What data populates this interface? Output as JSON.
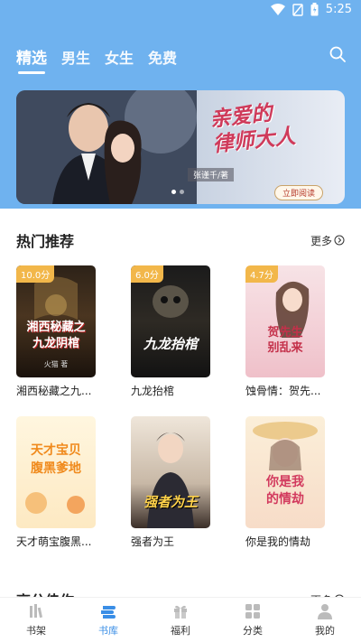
{
  "status": {
    "time": "5:25"
  },
  "tabs": [
    {
      "label": "精选",
      "active": true
    },
    {
      "label": "男生",
      "active": false
    },
    {
      "label": "女生",
      "active": false
    },
    {
      "label": "免费",
      "active": false
    }
  ],
  "banner": {
    "title_line1": "亲爱的",
    "title_line2": "律师大人",
    "author": "张谨千/著",
    "button": "立即阅读",
    "active_dot": 0
  },
  "hot": {
    "title": "热门推荐",
    "more": "更多",
    "books": [
      {
        "name": "湘西秘藏之九...",
        "score": "10.0分",
        "cover_text": "湘西秘藏之\n九龙阴棺",
        "cover_sub": "火猫 著"
      },
      {
        "name": "九龙抬棺",
        "score": "6.0分",
        "cover_text": "九龙抬棺",
        "cover_sub": ""
      },
      {
        "name": "蚀骨情：贺先...",
        "score": "4.7分",
        "cover_text": "贺先生\n别乱来",
        "cover_sub": ""
      },
      {
        "name": "天才萌宝腹黑...",
        "score": "",
        "cover_text": "天才宝贝\n腹黑爹地",
        "cover_sub": ""
      },
      {
        "name": "强者为王",
        "score": "",
        "cover_text": "强者为王",
        "cover_sub": ""
      },
      {
        "name": "你是我的情劫",
        "score": "",
        "cover_text": "你是我\n的情劫",
        "cover_sub": ""
      }
    ]
  },
  "next_section": {
    "title": "高分佳作",
    "more": "更多"
  },
  "nav": [
    {
      "label": "书架",
      "icon": "bookshelf-icon",
      "active": false
    },
    {
      "label": "书库",
      "icon": "library-icon",
      "active": true
    },
    {
      "label": "福利",
      "icon": "gift-icon",
      "active": false
    },
    {
      "label": "分类",
      "icon": "category-icon",
      "active": false
    },
    {
      "label": "我的",
      "icon": "user-icon",
      "active": false
    }
  ],
  "colors": {
    "header": "#6fb2ef",
    "accent": "#3a8ee6",
    "badge": "#f2b74a"
  }
}
